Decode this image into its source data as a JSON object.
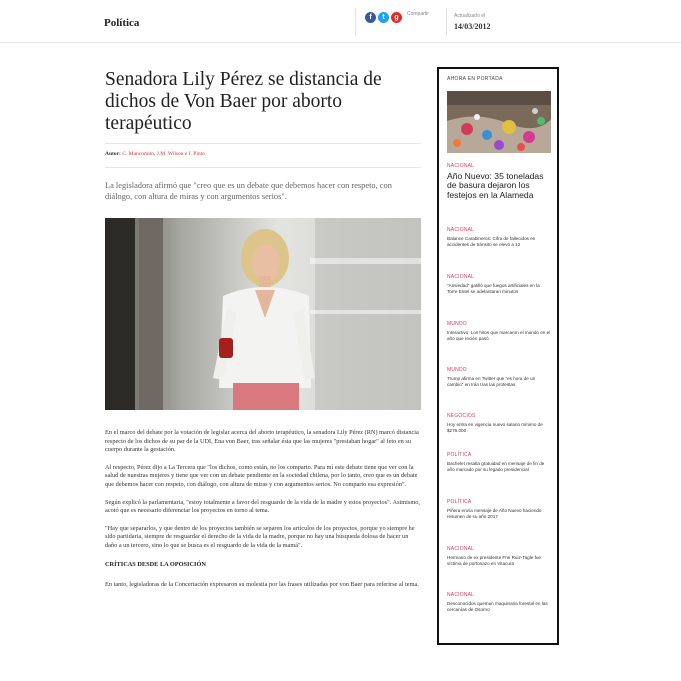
{
  "header": {
    "section": "Política",
    "share_label": "Compartir",
    "share_icons": [
      "facebook-icon",
      "twitter-icon",
      "google-plus-icon"
    ],
    "updated_label": "Actualizado el",
    "updated_date": "14/03/2012"
  },
  "article": {
    "title": "Senadora Lily Pérez se distancia de dichos de Von Baer por aborto terapéutico",
    "author_label": "Autor:",
    "authors": "C. Mancomito, J.M. Wilson e I. Pinto",
    "lead": "La legisladora afirmó que \"creo que es un debate que debemos hacer con respeto, con diálogo, con altura de miras y con argumentos serios\".",
    "paragraphs": [
      "En el marco del debate por la votación de legislar acerca del aborto terapéutico, la senadora Lily Pérez (RN) marcó distancia respecto de los dichos de su par de la UDI, Ena von Baer, tras señalar ésta que las mujeres \"prestaban hogar\" al feto en su cuerpo durante la gestación.",
      "Al respecto, Pérez dijo a La Tercera que \"los dichos, como están, no los comparto. Para mí este debate tiene que ver con la salud de nuestras mujeres y tiene que ver con un debate pendiente en la sociedad chilena, por lo tanto, creo que es un debate que debemos hacer con respeto, con diálogo, con altura de miras y con argumentos serios. No comparto esa expresión\".",
      "Según explicó la parlamentaria, \"estoy totalmente a favor del resguardo de la vida de la madre y estos proyectos\". Asimismo, acotó que es necesario diferenciar los proyectos en torno al tema.",
      "\"Hay que separarlos, y que dentro de los proyectos también se separen los artículos de los proyectos, porque yo siempre he sido partidaria, siempre de resguardar el derecho de la vida de la madre, porque no hay una búsqueda dolosa de hacer un daño a un tercero, sino lo que se busca es el resguardo de la vida de la mamá\"."
    ],
    "subheading": "CRÍTICAS DESDE LA OPOSICIÓN",
    "closing_paragraph": "En tanto, legisladoras de la Concertación expresaron su molestia por las frases utilizadas por von Baer para referirse al tema."
  },
  "sidebar": {
    "title": "AHORA EN PORTADA",
    "featured": {
      "category": "NACIONAL",
      "headline": "Año Nuevo: 35 toneladas de basura dejaron los festejos en la Alameda"
    },
    "items": [
      {
        "category": "NACIONAL",
        "headline": "Balance Carabineros: Cifra de fallecidos en accidentes de tránsito se elevó a 12"
      },
      {
        "category": "NACIONAL",
        "headline": "\"Ansiedad\" gatilló que fuegos artificiales en la Torre Entel se adelantaran minutos"
      },
      {
        "category": "MUNDO",
        "headline": "Interactivo: Los hitos que marcaron el mundo en el año que recién pasó"
      },
      {
        "category": "MUNDO",
        "headline": "Trump afirma en Twitter que \"es hora de un cambio\" en Irán tras las protestas"
      },
      {
        "category": "NEGOCIOS",
        "headline": "Hoy entra en vigencia nuevo salario mínimo de $276.000"
      },
      {
        "category": "POLÍTICA",
        "headline": "Bachelet resalta gratuidad en mensaje de fin de año marcado por su legado presidencial"
      },
      {
        "category": "POLÍTICA",
        "headline": "Piñera envía mensaje de Año Nuevo haciendo resumen de su año 2017"
      },
      {
        "category": "NACIONAL",
        "headline": "Hermano de ex presidente Frei Ruiz-Tagle fue víctima de portonazo en Vitacura"
      },
      {
        "category": "NACIONAL",
        "headline": "Desconocidos queman maquinaria forestal en las cercanías de Osorno"
      }
    ]
  },
  "colors": {
    "sidebar_category": "#d33c5f",
    "author_names": "#cc3333",
    "facebook": "#3b5998",
    "twitter": "#1da1f2",
    "google_plus": "#dd2c2c"
  }
}
